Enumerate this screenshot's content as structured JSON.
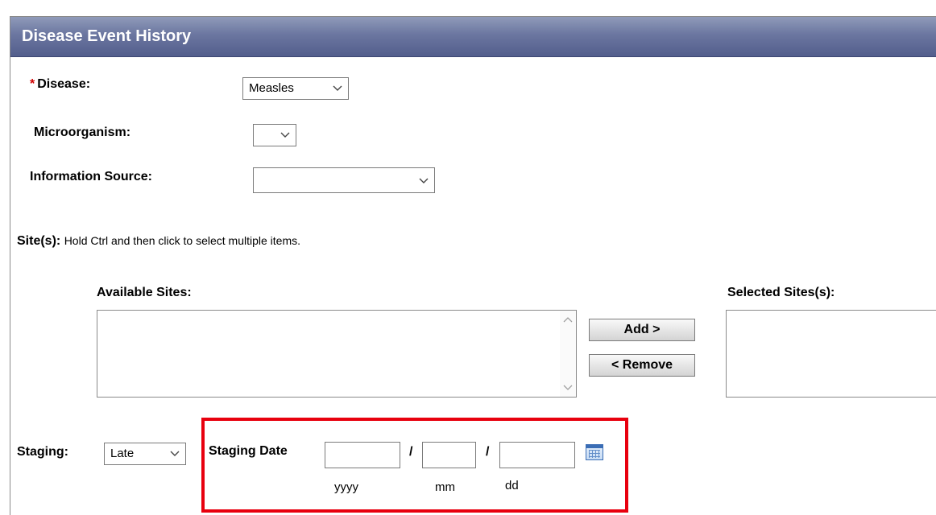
{
  "header": {
    "title": "Disease Event History"
  },
  "disease": {
    "required_marker": "*",
    "label": "Disease:",
    "value": "Measles"
  },
  "microorganism": {
    "label": "Microorganism:",
    "value": ""
  },
  "information_source": {
    "label": "Information Source:",
    "value": ""
  },
  "sites": {
    "label": "Site(s):",
    "note": "Hold Ctrl and then click to select multiple items.",
    "available_label": "Available Sites:",
    "selected_label": "Selected Sites(s):",
    "available_items": [],
    "selected_items": []
  },
  "buttons": {
    "add_label": "Add >",
    "remove_label": "< Remove"
  },
  "staging": {
    "label": "Staging:",
    "value": "Late"
  },
  "staging_date": {
    "label": "Staging Date",
    "separator": "/",
    "year_hint": "yyyy",
    "month_hint": "mm",
    "day_hint": "dd",
    "year_value": "",
    "month_value": "",
    "day_value": ""
  },
  "highlight_color": "#e8000e",
  "header_color": "#6b76a0",
  "icons": {
    "dropdown": "chevron-down-icon",
    "calendar": "calendar-icon"
  }
}
